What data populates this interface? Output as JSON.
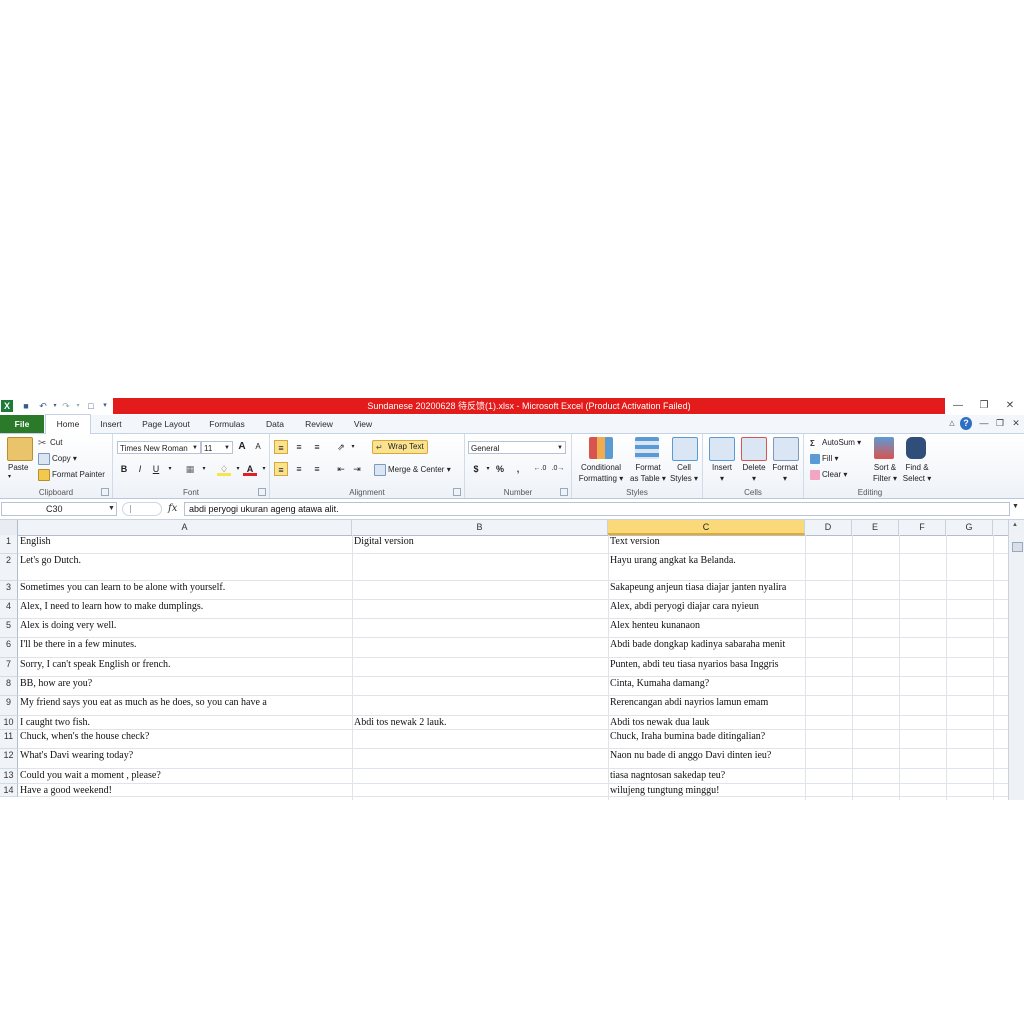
{
  "window": {
    "title": "Sundanese 20200628 待反馈(1).xlsx  -  Microsoft Excel (Product Activation Failed)",
    "app_icon": "X"
  },
  "ribbon_tabs": [
    "File",
    "Home",
    "Insert",
    "Page Layout",
    "Formulas",
    "Data",
    "Review",
    "View"
  ],
  "clipboard": {
    "paste": "Paste",
    "cut": "Cut",
    "copy": "Copy",
    "format_painter": "Format Painter",
    "label": "Clipboard"
  },
  "font": {
    "name": "Times New Roman",
    "size": "11",
    "bold": "B",
    "italic": "I",
    "underline": "U",
    "grow": "A",
    "shrink": "A",
    "label": "Font"
  },
  "alignment": {
    "wrap_text": "Wrap Text",
    "merge_center": "Merge & Center",
    "label": "Alignment"
  },
  "number": {
    "format": "General",
    "currency": "$",
    "percent": "%",
    "comma": ",",
    "label": "Number"
  },
  "styles": {
    "conditional": "Conditional",
    "conditional2": "Formatting",
    "format_table": "Format",
    "format_table2": "as Table",
    "cell_styles": "Cell",
    "cell_styles2": "Styles",
    "label": "Styles"
  },
  "cells": {
    "insert": "Insert",
    "delete": "Delete",
    "format": "Format",
    "label": "Cells"
  },
  "editing": {
    "autosum": "AutoSum",
    "fill": "Fill",
    "clear": "Clear",
    "sort": "Sort &",
    "sort2": "Filter",
    "find": "Find &",
    "find2": "Select",
    "label": "Editing"
  },
  "formula_bar": {
    "name_box": "C30",
    "fx": "fx",
    "value": "abdi peryogi ukuran ageng atawa alit."
  },
  "columns": [
    "A",
    "B",
    "C",
    "D",
    "E",
    "F",
    "G"
  ],
  "rows": [
    {
      "num": "1",
      "a": "English",
      "b": "Digital version",
      "c": "Text version"
    },
    {
      "num": "2",
      "a": "Let's go Dutch.",
      "b": "",
      "c": "Hayu urang angkat ka Belanda."
    },
    {
      "num": "3",
      "a": "Sometimes you can learn to be alone with yourself.",
      "b": "",
      "c": "Sakapeung anjeun tiasa diajar janten nyalira"
    },
    {
      "num": "4",
      "a": "Alex, I need to learn how to make dumplings.",
      "b": "",
      "c": "Alex, abdi peryogi diajar cara nyieun"
    },
    {
      "num": "5",
      "a": "Alex is doing very well.",
      "b": "",
      "c": "Alex henteu kunanaon"
    },
    {
      "num": "6",
      "a": " I'll be there in a few minutes.",
      "b": "",
      "c": "Abdi bade dongkap kadinya sabaraha menit"
    },
    {
      "num": "7",
      "a": "Sorry, I can't speak English or french.",
      "b": "",
      "c": "Punten, abdi teu tiasa nyarios basa Inggris"
    },
    {
      "num": "8",
      "a": "BB, how are you?",
      "b": "",
      "c": "Cinta, Kumaha damang?"
    },
    {
      "num": "9",
      "a": "My friend says you eat as much as he does, so you can have a",
      "b": "",
      "c": "Rerencangan abdi nayrios lamun emam"
    },
    {
      "num": "10",
      "a": "I caught two fish.",
      "b": "Abdi tos newak 2 lauk.",
      "c": "Abdi tos newak dua lauk"
    },
    {
      "num": "11",
      "a": "Chuck, when's the house check?",
      "b": "",
      "c": "Chuck, Iraha bumina bade ditingalian?"
    },
    {
      "num": "12",
      "a": "What's Davi wearing today?",
      "b": "",
      "c": "Naon nu bade di anggo Davi dinten ieu?"
    },
    {
      "num": "13",
      "a": "Could you wait a moment , please?",
      "b": "",
      "c": "tiasa nagntosan sakedap teu?"
    },
    {
      "num": "14",
      "a": "Have a good weekend!",
      "b": "",
      "c": "wilujeng tungtung minggu!"
    }
  ]
}
